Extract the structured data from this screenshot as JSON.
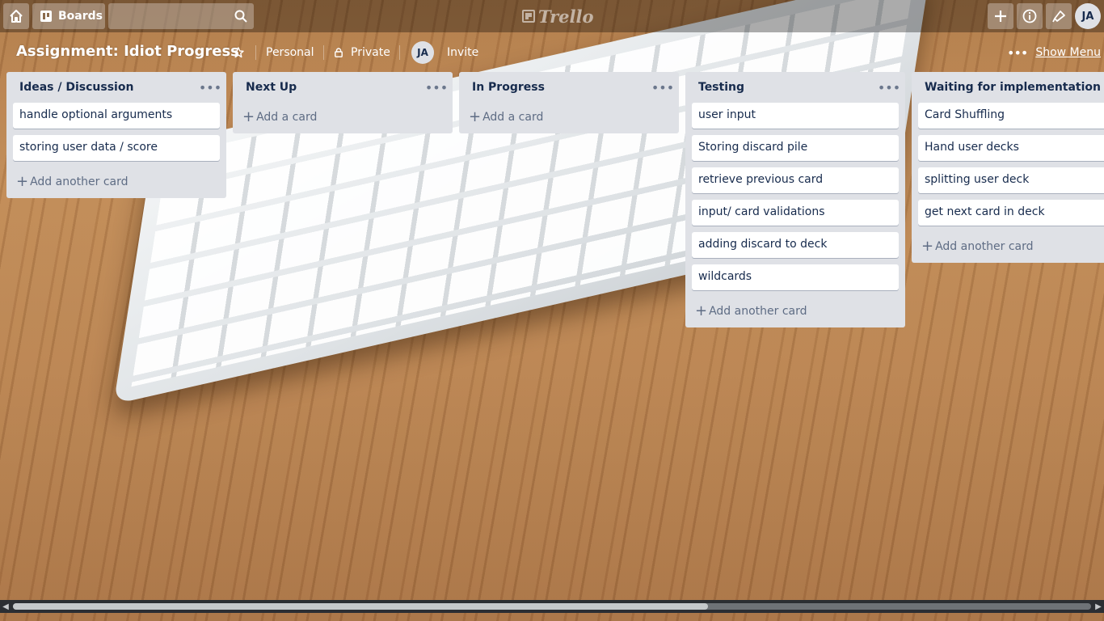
{
  "topbar": {
    "boards_label": "Boards",
    "search_placeholder": "",
    "logo_text": "Trello",
    "user_initials": "JA"
  },
  "board": {
    "title": "Assignment: Idiot Progress",
    "team": "Personal",
    "visibility": "Private",
    "member_initials": "JA",
    "invite_label": "Invite",
    "show_menu_label": "Show Menu"
  },
  "lists": [
    {
      "title": "Ideas / Discussion",
      "cards": [
        "handle optional arguments",
        "storing user data / score"
      ],
      "add_label": "Add another card"
    },
    {
      "title": "Next Up",
      "cards": [],
      "add_label": "Add a card"
    },
    {
      "title": "In Progress",
      "cards": [],
      "add_label": "Add a card"
    },
    {
      "title": "Testing",
      "cards": [
        "user input",
        "Storing discard pile",
        "retrieve previous card",
        "input/ card validations",
        "adding discard to deck",
        "wildcards"
      ],
      "add_label": "Add another card"
    },
    {
      "title": "Waiting for implementation",
      "cards": [
        "Card Shuffling",
        "Hand user decks",
        "splitting user deck",
        "get next card in deck"
      ],
      "add_label": "Add another card"
    }
  ],
  "icons": {
    "home": "home-icon",
    "boards": "boards-icon",
    "search": "search-icon",
    "add": "plus-icon",
    "info": "info-icon",
    "notifications": "bell-icon",
    "star": "star-icon",
    "lock": "lock-icon",
    "more": "more-icon"
  }
}
